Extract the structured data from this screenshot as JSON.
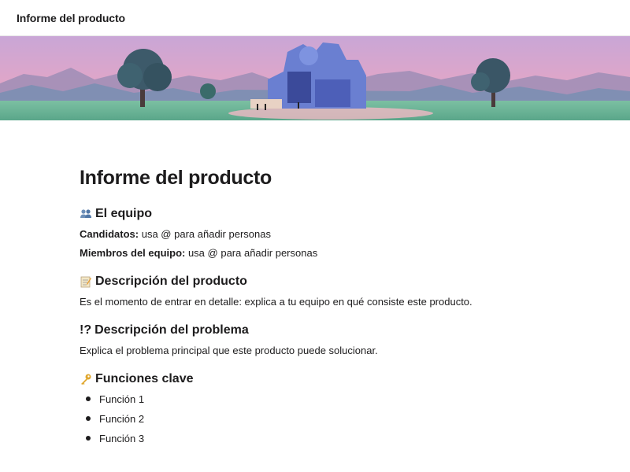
{
  "header": {
    "title": "Informe del producto"
  },
  "document": {
    "title": "Informe del producto",
    "sections": {
      "team": {
        "icon": "people-icon",
        "heading": "El equipo",
        "candidates_label": "Candidatos:",
        "candidates_value": " usa @ para añadir personas",
        "members_label": "Miembros del equipo:",
        "members_value": " usa @ para añadir personas"
      },
      "product": {
        "icon": "memo-icon",
        "heading": "Descripción del producto",
        "body": "Es el momento de entrar en detalle: explica a tu equipo en qué consiste este producto."
      },
      "problem": {
        "icon": "interrobang",
        "icon_text": "!?",
        "heading": "Descripción del problema",
        "body": "Explica el problema principal que este producto puede solucionar."
      },
      "features": {
        "icon": "key-icon",
        "heading": "Funciones clave",
        "items": [
          "Función 1",
          "Función 2",
          "Función 3"
        ]
      }
    }
  },
  "colors": {
    "sky_top": "#c7a9d8",
    "sky_bottom": "#f4a9bf",
    "mountains": "#8b7fa8",
    "grass": "#7fbf9f",
    "building": "#5b6fc7"
  }
}
